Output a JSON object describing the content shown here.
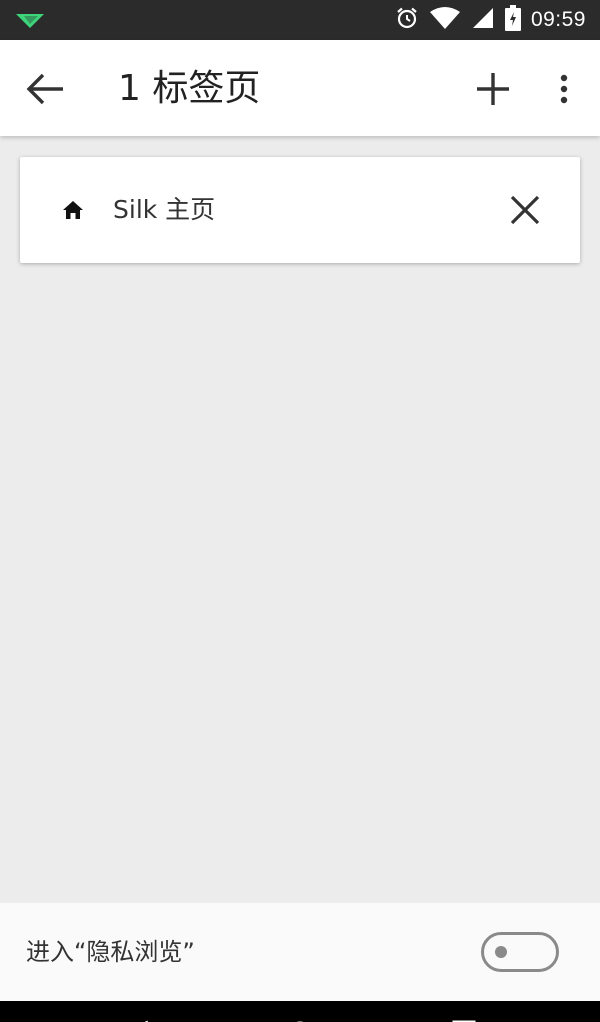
{
  "status_bar": {
    "time": "09:59",
    "icons": [
      "notification-app-icon",
      "alarm-icon",
      "wifi-icon",
      "signal-icon",
      "battery-icon"
    ]
  },
  "toolbar": {
    "title": "1 标签页",
    "icons": [
      "back-arrow-icon",
      "plus-icon",
      "more-vert-icon"
    ]
  },
  "tabs": [
    {
      "label": "Silk 主页",
      "icon": "home-icon",
      "close_icon": "close-icon"
    }
  ],
  "private_mode": {
    "label": "进入“隐私浏览”",
    "enabled": false
  },
  "nav_bar": {
    "icons": [
      "back-nav-icon",
      "home-nav-icon",
      "recents-nav-icon"
    ]
  },
  "colors": {
    "status_bar": "#2b2b2b",
    "toolbar": "#ffffff",
    "background": "#ececec",
    "toggle_off": "#8a8a8a",
    "app_icon": "#3dd47a"
  }
}
